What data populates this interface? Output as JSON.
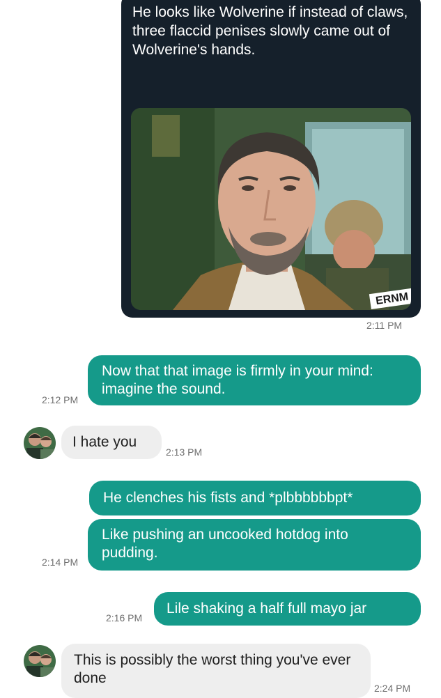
{
  "tweet": {
    "text": "He looks like Wolverine if instead of claws, three flaccid penises slowly came out of Wolverine's hands.",
    "watermark": "ERNM",
    "time": "2:11 PM"
  },
  "messages": [
    {
      "from": "me",
      "text": "Now that that image is firmly in your mind: imagine the sound.",
      "time": "2:12 PM"
    },
    {
      "from": "them",
      "text": "I hate you",
      "time": "2:13 PM"
    },
    {
      "from": "me",
      "text": "He clenches his fists and *plbbbbbbpt*",
      "time": ""
    },
    {
      "from": "me",
      "text": "Like pushing an uncooked hotdog into pudding.",
      "time": "2:14 PM"
    },
    {
      "from": "me",
      "text": "Lile shaking a half full mayo jar",
      "time": "2:16 PM"
    },
    {
      "from": "them",
      "text": "This is possibly the worst thing you've ever done",
      "time": "2:24 PM"
    }
  ],
  "colors": {
    "sent_bubble": "#159a8a",
    "received_bubble": "#eeeeee",
    "tweet_background": "#15202b"
  }
}
